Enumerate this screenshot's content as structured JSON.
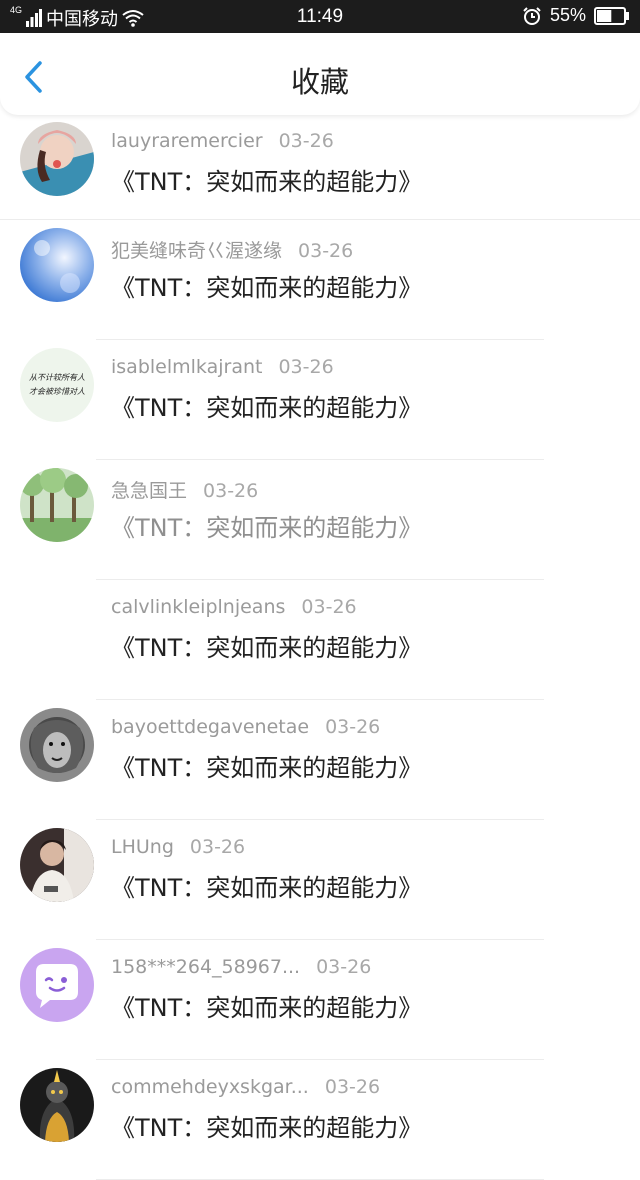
{
  "status_bar": {
    "network": "4G",
    "carrier": "中国移动",
    "time": "11:49",
    "battery": "55%",
    "battery_level": 0.55
  },
  "header": {
    "title": "收藏"
  },
  "items": [
    {
      "user": "lauyraremercier",
      "date": "03-26",
      "title": "《TNT：突如而来的超能力》"
    },
    {
      "user": "犯美缝味奇巜渥遂缘",
      "date": "03-26",
      "title": "《TNT：突如而来的超能力》"
    },
    {
      "user": "isablelmlkajrant",
      "date": "03-26",
      "title": "《TNT：突如而来的超能力》",
      "avatar_text": [
        "从不计较所有人",
        "才会被珍惜对人"
      ]
    },
    {
      "user": "急急国王",
      "date": "03-26",
      "title": "《TNT：突如而来的超能力》",
      "faded": true
    },
    {
      "user": "calvlinkleiplnjeans",
      "date": "03-26",
      "title": "《TNT：突如而来的超能力》"
    },
    {
      "user": "bayoettdegavenetae",
      "date": "03-26",
      "title": "《TNT：突如而来的超能力》"
    },
    {
      "user": "LHUng",
      "date": "03-26",
      "title": "《TNT：突如而来的超能力》"
    },
    {
      "user": "158***264_58967...",
      "date": "03-26",
      "title": "《TNT：突如而来的超能力》"
    },
    {
      "user": "commehdeyxskgar...",
      "date": "03-26",
      "title": "《TNT：突如而来的超能力》"
    }
  ]
}
